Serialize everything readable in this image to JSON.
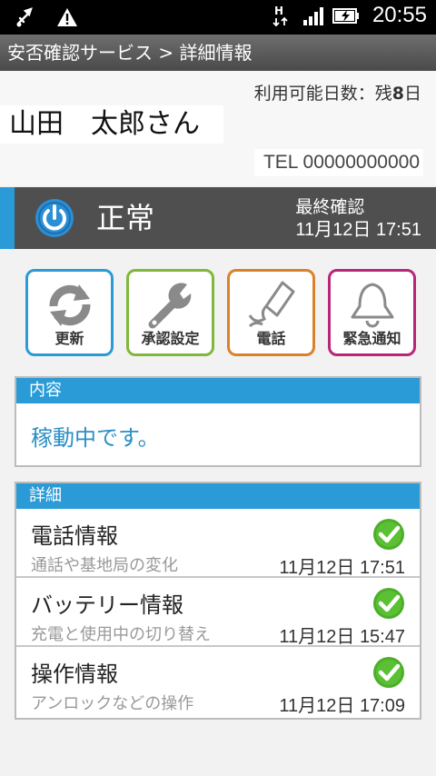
{
  "statusbar": {
    "time": "20:55",
    "network_type": "H"
  },
  "titlebar": {
    "title": "安否確認サービス > 詳細情報"
  },
  "header": {
    "days_label": "利用可能日数：残",
    "days_value": "8",
    "days_unit": "日",
    "username": "山田　太郎さん",
    "tel": "TEL 00000000000"
  },
  "status": {
    "state": "正常",
    "last_check_label": "最終確認",
    "last_check_value": "11月12日 17:51",
    "accent_color": "#2a9bd6"
  },
  "actions": [
    {
      "label": "更新",
      "icon": "refresh-icon",
      "color": "#2a9bd6"
    },
    {
      "label": "承認設定",
      "icon": "wrench-icon",
      "color": "#7fb83a"
    },
    {
      "label": "電話",
      "icon": "phone-icon",
      "color": "#d9822b"
    },
    {
      "label": "緊急通知",
      "icon": "bell-icon",
      "color": "#b8267a"
    }
  ],
  "content": {
    "header": "内容",
    "text": "稼動中です。"
  },
  "details": {
    "header": "詳細",
    "rows": [
      {
        "title": "電話情報",
        "sub": "通話や基地局の変化",
        "time": "11月12日 17:51",
        "status_icon": "check-icon"
      },
      {
        "title": "バッテリー情報",
        "sub": "充電と使用中の切り替え",
        "time": "11月12日 15:47",
        "status_icon": "check-icon"
      },
      {
        "title": "操作情報",
        "sub": "アンロックなどの操作",
        "time": "11月12日 17:09",
        "status_icon": "check-icon"
      }
    ]
  }
}
